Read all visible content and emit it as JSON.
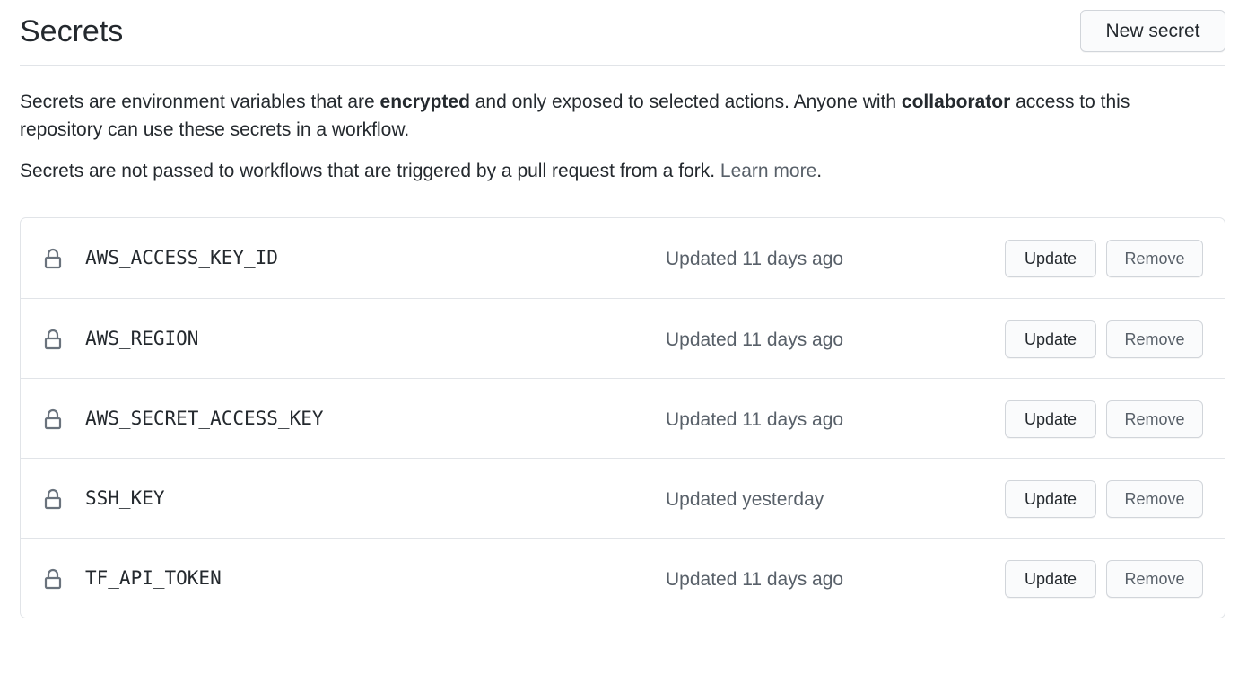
{
  "header": {
    "title": "Secrets",
    "new_secret_label": "New secret"
  },
  "description": {
    "line1_part1": "Secrets are environment variables that are ",
    "line1_bold1": "encrypted",
    "line1_part2": " and only exposed to selected actions. Anyone with ",
    "line1_bold2": "collaborator",
    "line1_part3": " access to this repository can use these secrets in a workflow.",
    "line2_text": "Secrets are not passed to workflows that are triggered by a pull request from a fork. ",
    "line2_link": "Learn more",
    "line2_end": "."
  },
  "secrets": [
    {
      "name": "AWS_ACCESS_KEY_ID",
      "updated": "Updated 11 days ago",
      "icon": "lock-icon"
    },
    {
      "name": "AWS_REGION",
      "updated": "Updated 11 days ago",
      "icon": "lock-icon"
    },
    {
      "name": "AWS_SECRET_ACCESS_KEY",
      "updated": "Updated 11 days ago",
      "icon": "lock-icon"
    },
    {
      "name": "SSH_KEY",
      "updated": "Updated yesterday",
      "icon": "lock-icon"
    },
    {
      "name": "TF_API_TOKEN",
      "updated": "Updated 11 days ago",
      "icon": "lock-icon"
    }
  ],
  "actions": {
    "update_label": "Update",
    "remove_label": "Remove"
  },
  "colors": {
    "text": "#24292e",
    "muted": "#586069",
    "border": "#e1e4e8",
    "button_bg": "#fafbfc"
  }
}
